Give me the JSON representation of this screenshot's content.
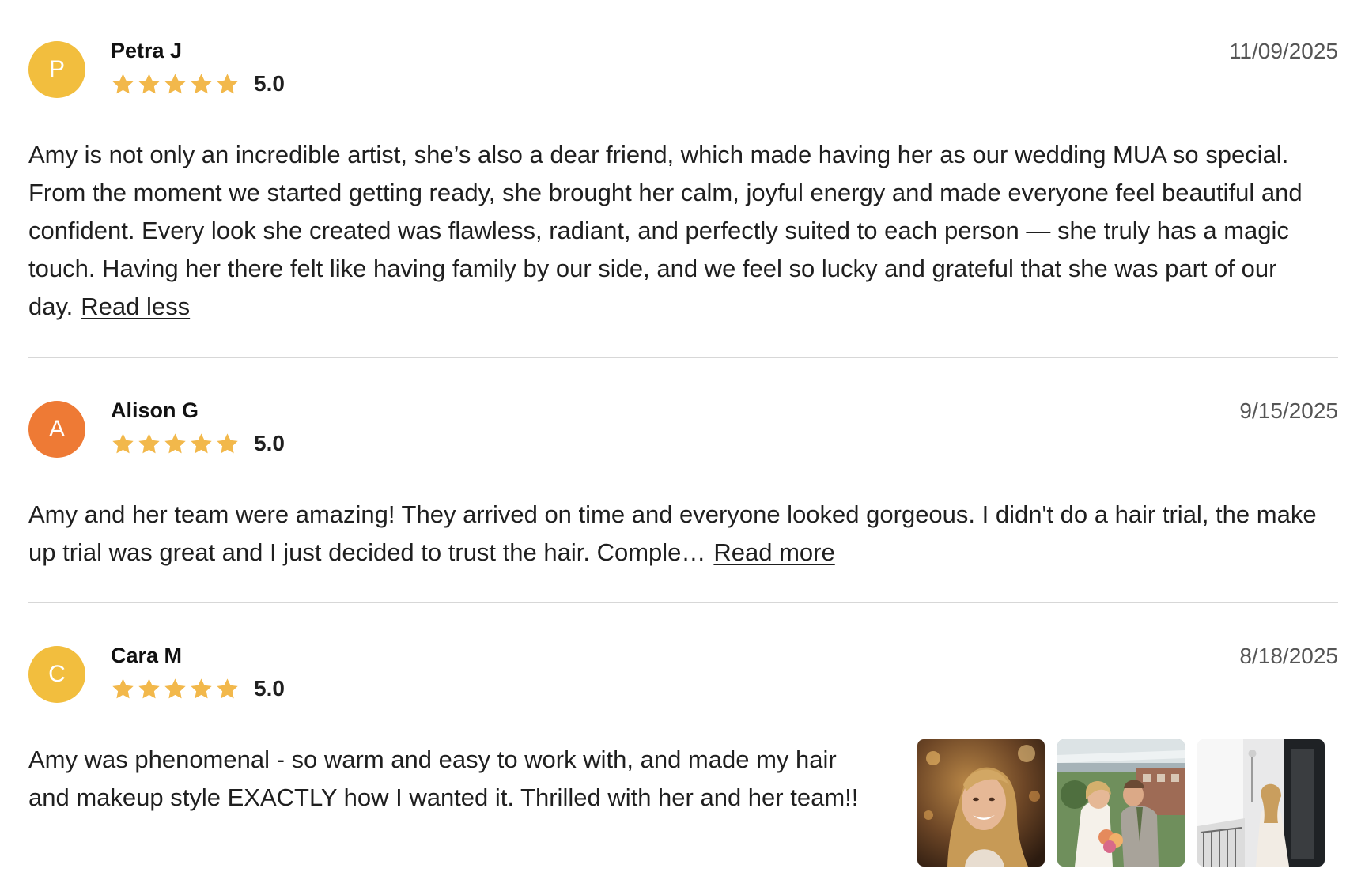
{
  "reviews": [
    {
      "avatar_letter": "P",
      "avatar_color": "#F2BE3E",
      "reviewer": "Petra J",
      "rating": "5.0",
      "stars": 5,
      "date": "11/09/2025",
      "text": "Amy is not only an incredible artist, she’s also a dear friend, which made having her as our wedding MUA so special. From the moment we started getting ready, she brought her calm, joyful energy and made everyone feel beautiful and confident. Every look she created was flawless, radiant, and perfectly suited to each person — she truly has a magic touch. Having her there felt like having family by our side, and we feel so lucky and grateful that she was part of our day.",
      "link": "Read less"
    },
    {
      "avatar_letter": "A",
      "avatar_color": "#EE7A35",
      "reviewer": "Alison G",
      "rating": "5.0",
      "stars": 5,
      "date": "9/15/2025",
      "text": "Amy and her team were amazing! They arrived on time and everyone looked gorgeous. I didn't do a hair trial, the make up trial was great and I just decided to trust the hair. Comple…",
      "link": "Read more"
    },
    {
      "avatar_letter": "C",
      "avatar_color": "#F2BE3E",
      "reviewer": "Cara M",
      "rating": "5.0",
      "stars": 5,
      "date": "8/18/2025",
      "text": "Amy was phenomenal - so warm and easy to work with, and made my hair and makeup style EXACTLY how I wanted it. Thrilled with her and her team!!",
      "photos": [
        "bride-portrait-photo",
        "couple-kiss-photo",
        "bride-mirror-photo"
      ]
    }
  ],
  "colors": {
    "star": "#F2B84B",
    "divider": "#D7D7D7",
    "date": "#555555"
  }
}
